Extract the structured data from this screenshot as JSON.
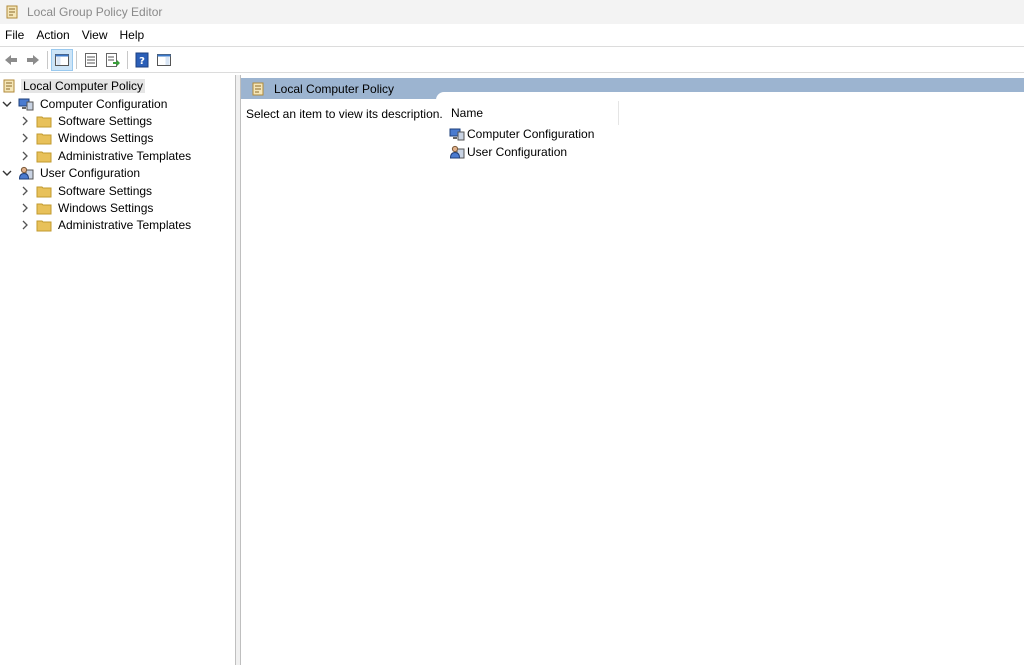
{
  "window": {
    "title": "Local Group Policy Editor",
    "icon": "policy-scroll-icon"
  },
  "menu": [
    "File",
    "Action",
    "View",
    "Help"
  ],
  "toolbar": {
    "buttons": [
      "back-arrow-icon",
      "forward-arrow-icon",
      "show-hide-console-tree-icon",
      "properties-icon",
      "export-list-icon",
      "help-icon",
      "show-hide-action-pane-icon"
    ]
  },
  "tree": {
    "root": "Local Computer Policy",
    "computer": {
      "label": "Computer Configuration",
      "children": [
        "Software Settings",
        "Windows Settings",
        "Administrative Templates"
      ]
    },
    "user": {
      "label": "User Configuration",
      "children": [
        "Software Settings",
        "Windows Settings",
        "Administrative Templates"
      ]
    }
  },
  "content": {
    "header": "Local Computer Policy",
    "description": "Select an item to view its description.",
    "column_name": "Name",
    "items": [
      "Computer Configuration",
      "User Configuration"
    ]
  },
  "colors": {
    "header_band": "#9cb4d0",
    "folder": "#e8c15a",
    "selection": "#e5e5e5"
  }
}
